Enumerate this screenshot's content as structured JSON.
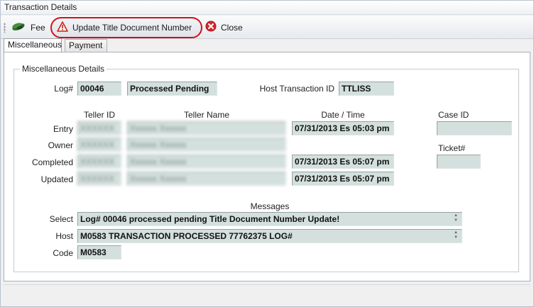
{
  "window": {
    "title": "Transaction Details"
  },
  "toolbar": {
    "fee_label": "Fee",
    "update_label": "Update Title Document Number",
    "close_label": "Close"
  },
  "tabs": [
    {
      "label": "Miscellaneous",
      "active": true
    },
    {
      "label": "Payment",
      "active": false
    }
  ],
  "group": {
    "title": "Miscellaneous Details"
  },
  "log": {
    "label": "Log#",
    "number": "00046",
    "status": "Processed Pending",
    "host_label": "Host Transaction ID",
    "host_value": "TTLISS"
  },
  "table_headers": {
    "teller_id": "Teller ID",
    "teller_name": "Teller Name",
    "date_time": "Date / Time"
  },
  "rows": [
    {
      "label": "Entry",
      "teller_id": "XXXXXX",
      "teller_name": "Xxxxxx Xxxxxx",
      "date_time": "07/31/2013 Es 05:03 pm"
    },
    {
      "label": "Owner",
      "teller_id": "XXXXXX",
      "teller_name": "Xxxxxx Xxxxxx",
      "date_time": ""
    },
    {
      "label": "Completed",
      "teller_id": "XXXXXX",
      "teller_name": "Xxxxxx Xxxxxx",
      "date_time": "07/31/2013 Es 05:07 pm"
    },
    {
      "label": "Updated",
      "teller_id": "XXXXXX",
      "teller_name": "Xxxxxx Xxxxxx",
      "date_time": "07/31/2013 Es 05:07 pm"
    }
  ],
  "right_fields": {
    "case_id_label": "Case ID",
    "case_id_value": "",
    "ticket_label": "Ticket#",
    "ticket_value": ""
  },
  "messages": {
    "header": "Messages",
    "select_label": "Select",
    "select_value": "Log# 00046 processed pending Title Document Number Update!",
    "host_label": "Host",
    "host_value": "M0583 TRANSACTION PROCESSED 77762375 LOG#",
    "code_label": "Code",
    "code_value": "M0583"
  },
  "colors": {
    "field_bg": "#d3e0dd",
    "highlight_ring": "#d4101a"
  }
}
